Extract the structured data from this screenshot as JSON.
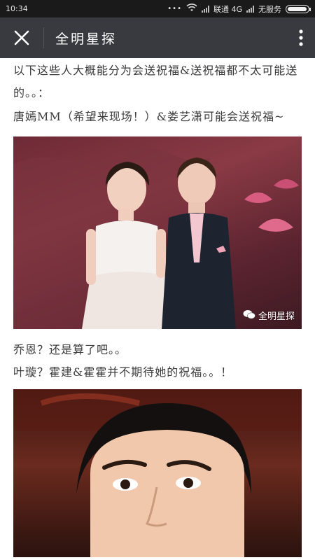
{
  "status_bar": {
    "time": "10:34",
    "dots": "•••",
    "network": "联通 4G",
    "service": "无服务",
    "battery_level": 0.95
  },
  "toolbar": {
    "title": "全明星探"
  },
  "article": {
    "paragraph_1": "以下这些人大概能分为会送祝福&送祝福都不太可能送的。。：",
    "paragraph_2": "唐嫣MM（希望来现场！）&娄艺潇可能会送祝福~",
    "photo_1_watermark": "全明星探",
    "paragraph_3": "乔恩？还是算了吧。。",
    "paragraph_4": "叶璇？霍建&霍霍并不期待她的祝福。。！"
  },
  "colors": {
    "status_bar_bg": "#1a1a1a",
    "toolbar_bg": "#393a3f",
    "text": "#3a3a3a"
  }
}
